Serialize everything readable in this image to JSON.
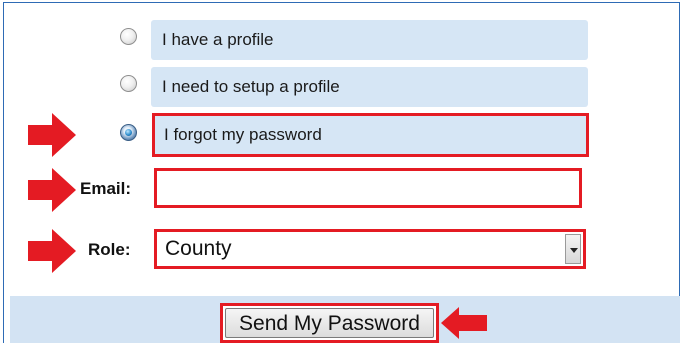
{
  "options": [
    {
      "label": "I have a profile",
      "checked": false
    },
    {
      "label": "I need to setup a profile",
      "checked": false
    },
    {
      "label": "I forgot my password",
      "checked": true
    }
  ],
  "email": {
    "label": "Email:",
    "value": ""
  },
  "role": {
    "label": "Role:",
    "selected": "County"
  },
  "submit": {
    "label": "Send My Password"
  },
  "colors": {
    "highlight": "#e41b23",
    "option_bg": "#d6e6f5",
    "footer_bg": "#d3e3f3"
  }
}
